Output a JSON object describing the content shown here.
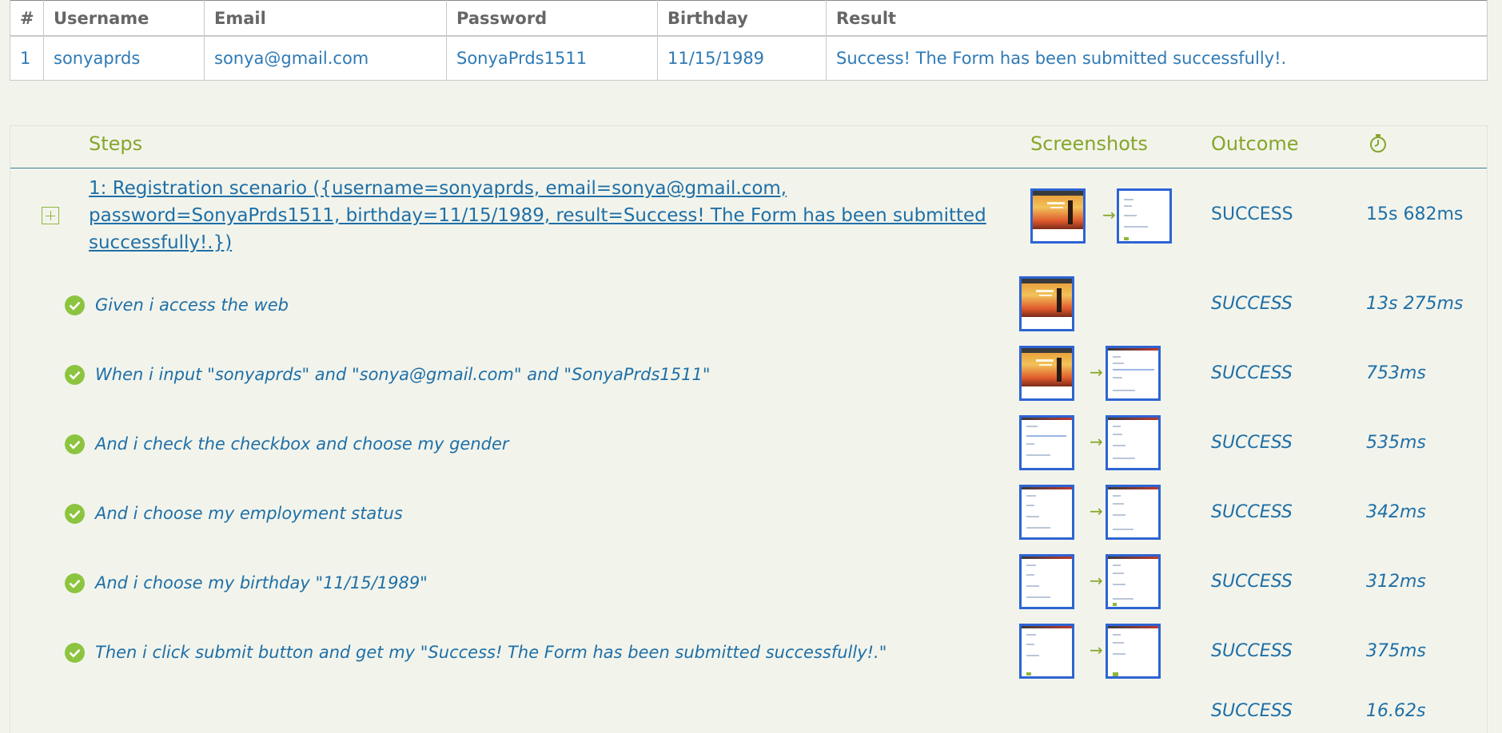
{
  "table": {
    "headers": [
      "#",
      "Username",
      "Email",
      "Password",
      "Birthday",
      "Result"
    ],
    "row": [
      "1",
      "sonyaprds",
      "sonya@gmail.com",
      "SonyaPrds1511",
      "11/15/1989",
      "Success! The Form has been submitted successfully!."
    ]
  },
  "steps_header": {
    "steps": "Steps",
    "screenshots": "Screenshots",
    "outcome": "Outcome",
    "duration_icon": "stopwatch-icon"
  },
  "scenario": {
    "title": "1: Registration scenario ({username=sonyaprds, email=sonya@gmail.com, password=SonyaPrds1511, birthday=11/15/1989, result=Success! The Form has been submitted successfully!.})",
    "outcome": "SUCCESS",
    "duration": "15s 682ms"
  },
  "steps": [
    {
      "text": "Given i access the web",
      "outcome": "SUCCESS",
      "duration": "13s 275ms"
    },
    {
      "text": "When i input \"sonyaprds\" and \"sonya@gmail.com\" and \"SonyaPrds1511\"",
      "outcome": "SUCCESS",
      "duration": "753ms"
    },
    {
      "text": "And i check the checkbox and choose my gender",
      "outcome": "SUCCESS",
      "duration": "535ms"
    },
    {
      "text": "And i choose my employment status",
      "outcome": "SUCCESS",
      "duration": "342ms"
    },
    {
      "text": "And i choose my birthday \"11/15/1989\"",
      "outcome": "SUCCESS",
      "duration": "312ms"
    },
    {
      "text": "Then i click submit button and get my \"Success! The Form has been submitted successfully!.\"",
      "outcome": "SUCCESS",
      "duration": "375ms"
    }
  ],
  "total": {
    "outcome": "SUCCESS",
    "duration": "16.62s"
  },
  "arrow_glyph": "→",
  "colors": {
    "accent": "#86a629",
    "link": "#1f6fa6",
    "thumb_border": "#2e64d3",
    "check": "#8cc43f"
  }
}
